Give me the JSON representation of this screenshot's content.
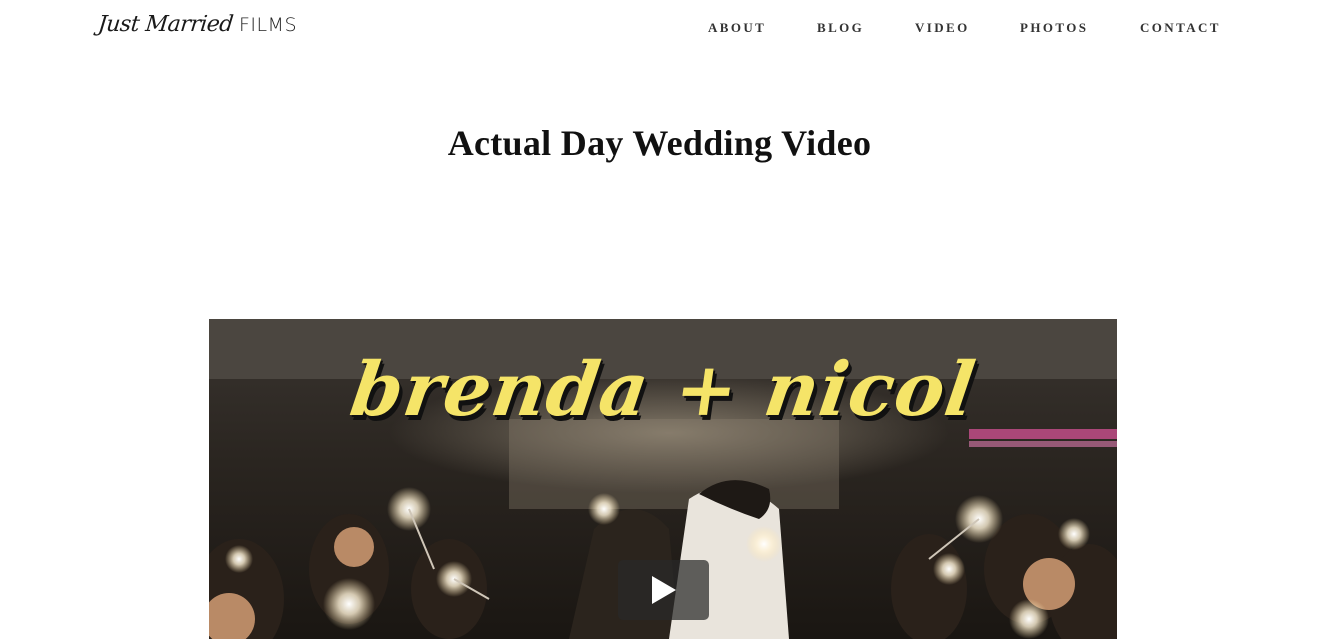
{
  "header": {
    "logo": {
      "script": "Just Married",
      "word": "FILMS"
    },
    "nav": [
      {
        "label": "ABOUT"
      },
      {
        "label": "BLOG"
      },
      {
        "label": "VIDEO"
      },
      {
        "label": "PHOTOS"
      },
      {
        "label": "CONTACT"
      }
    ]
  },
  "main": {
    "title": "Actual Day Wedding Video",
    "video": {
      "overlay_title": "brenda + nicol",
      "play_icon": "play-icon",
      "colors": {
        "overlay_text": "#f5e468",
        "play_bg": "#2b2b2b"
      }
    }
  }
}
